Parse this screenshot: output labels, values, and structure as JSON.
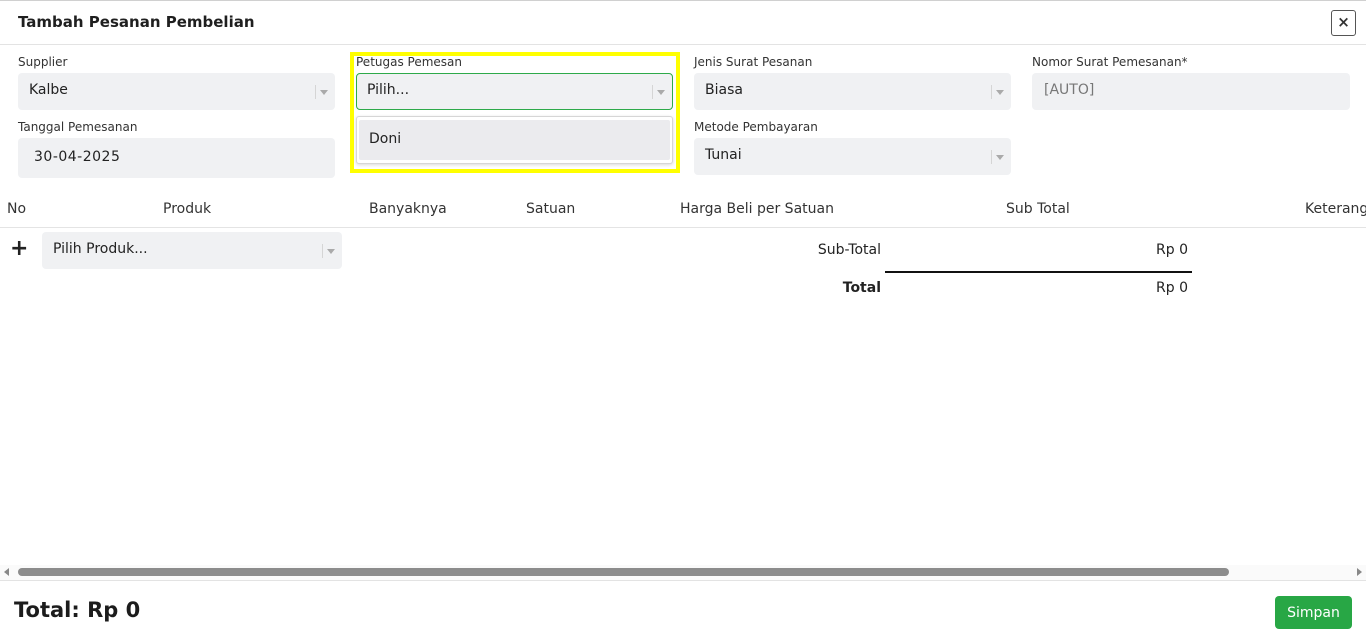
{
  "modal": {
    "title": "Tambah Pesanan Pembelian",
    "close_label": "×"
  },
  "form": {
    "supplier": {
      "label": "Supplier",
      "value": "Kalbe"
    },
    "petugas": {
      "label": "Petugas Pemesan",
      "placeholder": "Pilih...",
      "options": [
        "Doni"
      ]
    },
    "jenis_surat": {
      "label": "Jenis Surat Pesanan",
      "value": "Biasa"
    },
    "nomor_surat": {
      "label": "Nomor Surat Pemesanan*",
      "value": "[AUTO]"
    },
    "tanggal": {
      "label": "Tanggal Pemesanan",
      "value": "30-04-2025"
    },
    "metode": {
      "label": "Metode Pembayaran",
      "value": "Tunai"
    }
  },
  "table": {
    "headers": [
      "No",
      "Produk",
      "Banyaknya",
      "Satuan",
      "Harga Beli per Satuan",
      "Sub Total",
      "Keterang"
    ],
    "add_row_label": "+",
    "product_placeholder": "Pilih Produk..."
  },
  "summary": {
    "subtotal_label": "Sub-Total",
    "subtotal_value": "Rp 0",
    "total_label": "Total",
    "total_value": "Rp 0"
  },
  "footer": {
    "total_text": "Total: Rp 0",
    "save_label": "Simpan"
  },
  "colors": {
    "accent_green": "#28a745",
    "highlight": "#ffff00",
    "focus_border": "#2eaa4a"
  }
}
